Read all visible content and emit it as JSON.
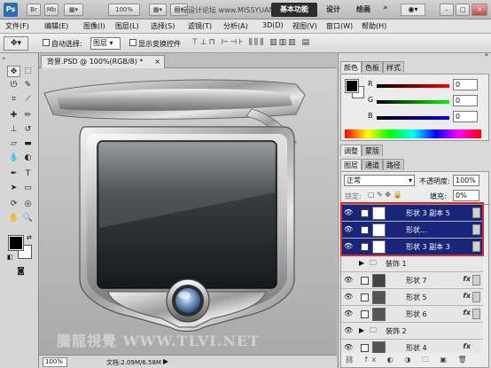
{
  "titlebar": {
    "app_logo": "Ps",
    "zoom": "100%",
    "workspace_active": "基本功能",
    "workspace_items": [
      "设计",
      "绘画"
    ],
    "watermark_site": "思缘设计论坛 www.MISSYUAN.COM"
  },
  "menubar": {
    "items": [
      "文件(F)",
      "编辑(E)",
      "图像(I)",
      "图层(L)",
      "选择(S)",
      "滤镜(T)",
      "分析(A)",
      "3D(D)",
      "视图(V)",
      "窗口(W)",
      "帮助(H)"
    ]
  },
  "options": {
    "auto_select_label": "自动选择:",
    "auto_select_value": "图层",
    "show_transform_label": "显示变换控件"
  },
  "document": {
    "tab_title": "背景.PSD @ 100%(RGB/8) *"
  },
  "statusbar": {
    "zoom": "100%",
    "doc_info": "文档:2.09M/6.58M"
  },
  "watermark": "騰龍視覺 WWW.TLVI.NET",
  "color_panel": {
    "tabs": [
      "颜色",
      "色板",
      "样式"
    ],
    "r_label": "R",
    "g_label": "G",
    "b_label": "B",
    "r_value": "0",
    "g_value": "0",
    "b_value": "0"
  },
  "adjust_tabs": [
    "调整",
    "蒙版"
  ],
  "layers_panel": {
    "tabs": [
      "图层",
      "通道",
      "路径"
    ],
    "blend_mode": "正常",
    "opacity_label": "不透明度:",
    "opacity_value": "100%",
    "lock_label": "锁定:",
    "fill_label": "填充:",
    "fill_value": "0%",
    "layers": [
      {
        "name": "形状 3 副本 5",
        "selected": true,
        "fx": false
      },
      {
        "name": "形状...",
        "selected": true,
        "fx": false
      },
      {
        "name": "形状 3 副本 3",
        "selected": true,
        "fx": false
      },
      {
        "name": "装饰 1",
        "selected": false,
        "group": true
      },
      {
        "name": "形状 7",
        "selected": false,
        "fx": true
      },
      {
        "name": "形状 5",
        "selected": false,
        "fx": true
      },
      {
        "name": "形状 6",
        "selected": false,
        "fx": true
      },
      {
        "name": "装饰 2",
        "selected": false,
        "group": true
      },
      {
        "name": "形状 4",
        "selected": false,
        "fx": true
      }
    ]
  },
  "colors": {
    "selection": "#19257a",
    "highlight": "#d0302a"
  }
}
